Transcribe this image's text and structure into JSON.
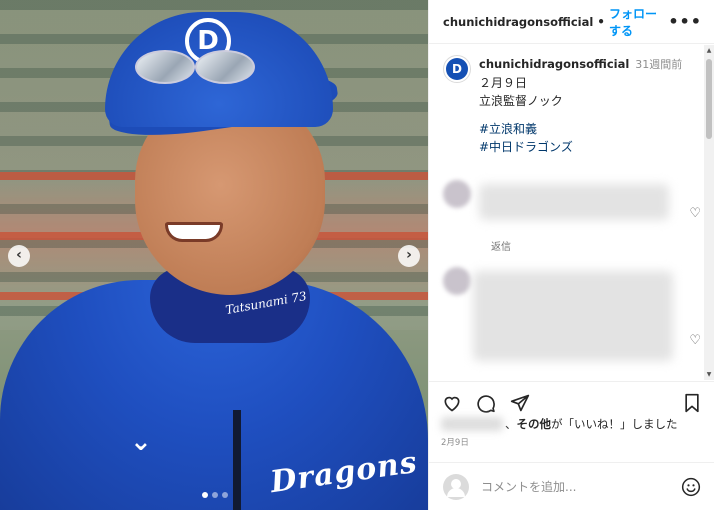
{
  "post": {
    "username": "chunichidragonsofficial",
    "separator": "•",
    "follow_label": "フォローする",
    "more_label": "•••",
    "time_ago": "31週間前",
    "caption_lines": [
      "２月９日",
      "立浪監督ノック"
    ],
    "hashtags": [
      "#立浪和義",
      "#中日ドラゴンズ"
    ],
    "avatar_logo": "D"
  },
  "photo": {
    "cap_logo": "D",
    "collar_text": "Tatsunami 73",
    "jacket_text": "Dragons",
    "prev_arrow": "‹",
    "next_arrow": "›",
    "carousel": {
      "total": 3,
      "active": 1
    }
  },
  "comments": {
    "reply_label": "返信"
  },
  "likes": {
    "others_label": "その他",
    "liked_suffix": "が「いいね！」しました",
    "date": "2月9日"
  },
  "composer": {
    "placeholder": "コメントを追加..."
  },
  "icons": [
    "heart-icon",
    "comment-icon",
    "share-icon",
    "bookmark-icon",
    "emoji-icon",
    "more-icon"
  ]
}
